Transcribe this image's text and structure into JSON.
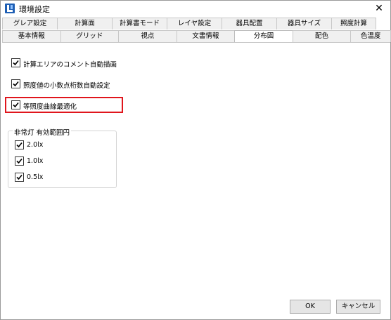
{
  "window": {
    "title": "環境設定",
    "close_glyph": "✕"
  },
  "tabs": {
    "row1": [
      "グレア設定",
      "計算面",
      "計算書モード",
      "レイヤ設定",
      "器具配置",
      "器具サイズ",
      "照度計算"
    ],
    "row2": [
      "基本情報",
      "グリッド",
      "視点",
      "文書情報",
      "分布図",
      "配色",
      "色温度"
    ],
    "active": "分布図"
  },
  "options": [
    {
      "label": "計算エリアのコメント自動描画",
      "checked": true
    },
    {
      "label": "照度値の小数点桁数自動設定",
      "checked": true
    },
    {
      "label": "等照度曲線最適化",
      "checked": true
    }
  ],
  "emergency_group": {
    "title": "非常灯 有効範囲円",
    "items": [
      {
        "label": "2.0lx",
        "checked": true
      },
      {
        "label": "1.0lx",
        "checked": true
      },
      {
        "label": "0.5lx",
        "checked": true
      }
    ]
  },
  "buttons": {
    "ok": "OK",
    "cancel": "キャンセル"
  },
  "colors": {
    "highlight": "#e0161d",
    "icon": "#1f5fb4"
  }
}
